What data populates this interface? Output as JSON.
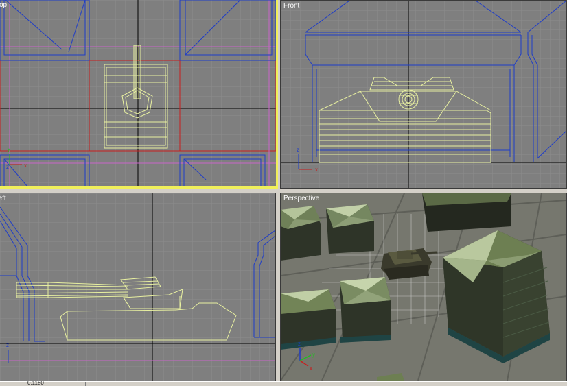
{
  "viewports": {
    "top": {
      "label": "Top"
    },
    "front": {
      "label": "Front"
    },
    "left": {
      "label": "Left"
    },
    "perspective": {
      "label": "Perspective"
    }
  },
  "axes": {
    "x": "x",
    "y": "y",
    "z": "z"
  },
  "status": {
    "value": "0.1180"
  },
  "colors": {
    "viewport_bg": "#7f7f7f",
    "grid": "#8c8c8c",
    "wire_building": "#1e3cc8",
    "wire_tank": "#e8f0a0",
    "active_border": "#f0f05a",
    "red_line": "#c81e1e",
    "magenta_line": "#c864c8"
  }
}
